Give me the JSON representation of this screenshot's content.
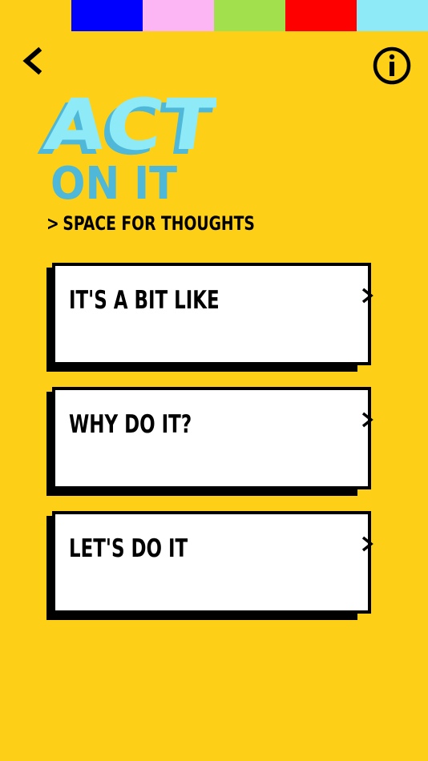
{
  "palette": {
    "swatches": [
      "#FDD017",
      "#0000FF",
      "#FBB6F3",
      "#A3E04E",
      "#FF0000",
      "#8FEAF8"
    ],
    "background": "#FDD017",
    "title_light": "#8FEAF8",
    "title_shadow": "#4FB8D8",
    "title_secondary": "#4FB8D8"
  },
  "header": {
    "back_icon": "back-chevron",
    "info_icon": "info-circle"
  },
  "title": {
    "line1": "ACT",
    "line2": "ON IT"
  },
  "subtitle": {
    "arrow": ">",
    "text": "SPACE FOR THOUGHTS"
  },
  "cards": [
    {
      "label": "IT'S A BIT LIKE",
      "chevron": ">"
    },
    {
      "label": "WHY DO IT?",
      "chevron": ">"
    },
    {
      "label": "LET'S DO IT",
      "chevron": ">"
    }
  ]
}
